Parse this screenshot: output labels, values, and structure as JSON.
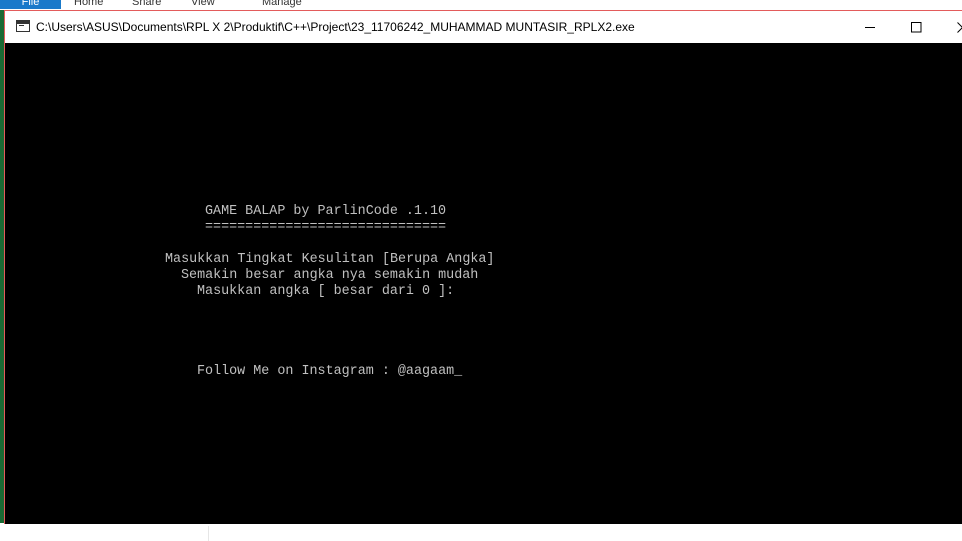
{
  "explorer_ribbon": {
    "tabs": [
      "File",
      "Home",
      "Share",
      "View",
      "Manage"
    ]
  },
  "window": {
    "title": "C:\\Users\\ASUS\\Documents\\RPL X 2\\Produktif\\C++\\Project\\23_11706242_MUHAMMAD MUNTASIR_RPLX2.exe",
    "icon": "console-app-icon",
    "controls": {
      "minimize": "minimize-icon",
      "maximize": "maximize-icon",
      "close": "close-icon"
    }
  },
  "console": {
    "header": "GAME BALAP by ParlinCode .1.10",
    "separator": "==============================",
    "prompt_line1": "Masukkan Tingkat Kesulitan [Berupa Angka]",
    "prompt_line2": "Semakin besar angka nya semakin mudah",
    "prompt_line3": "Masukkan angka [ besar dari 0 ]:",
    "footer": "Follow Me on Instagram : @aagaam_"
  },
  "colors": {
    "console_bg": "#000000",
    "console_text": "#c0c0c0",
    "window_border": "#e35b5b",
    "file_tab": "#1979ca"
  }
}
